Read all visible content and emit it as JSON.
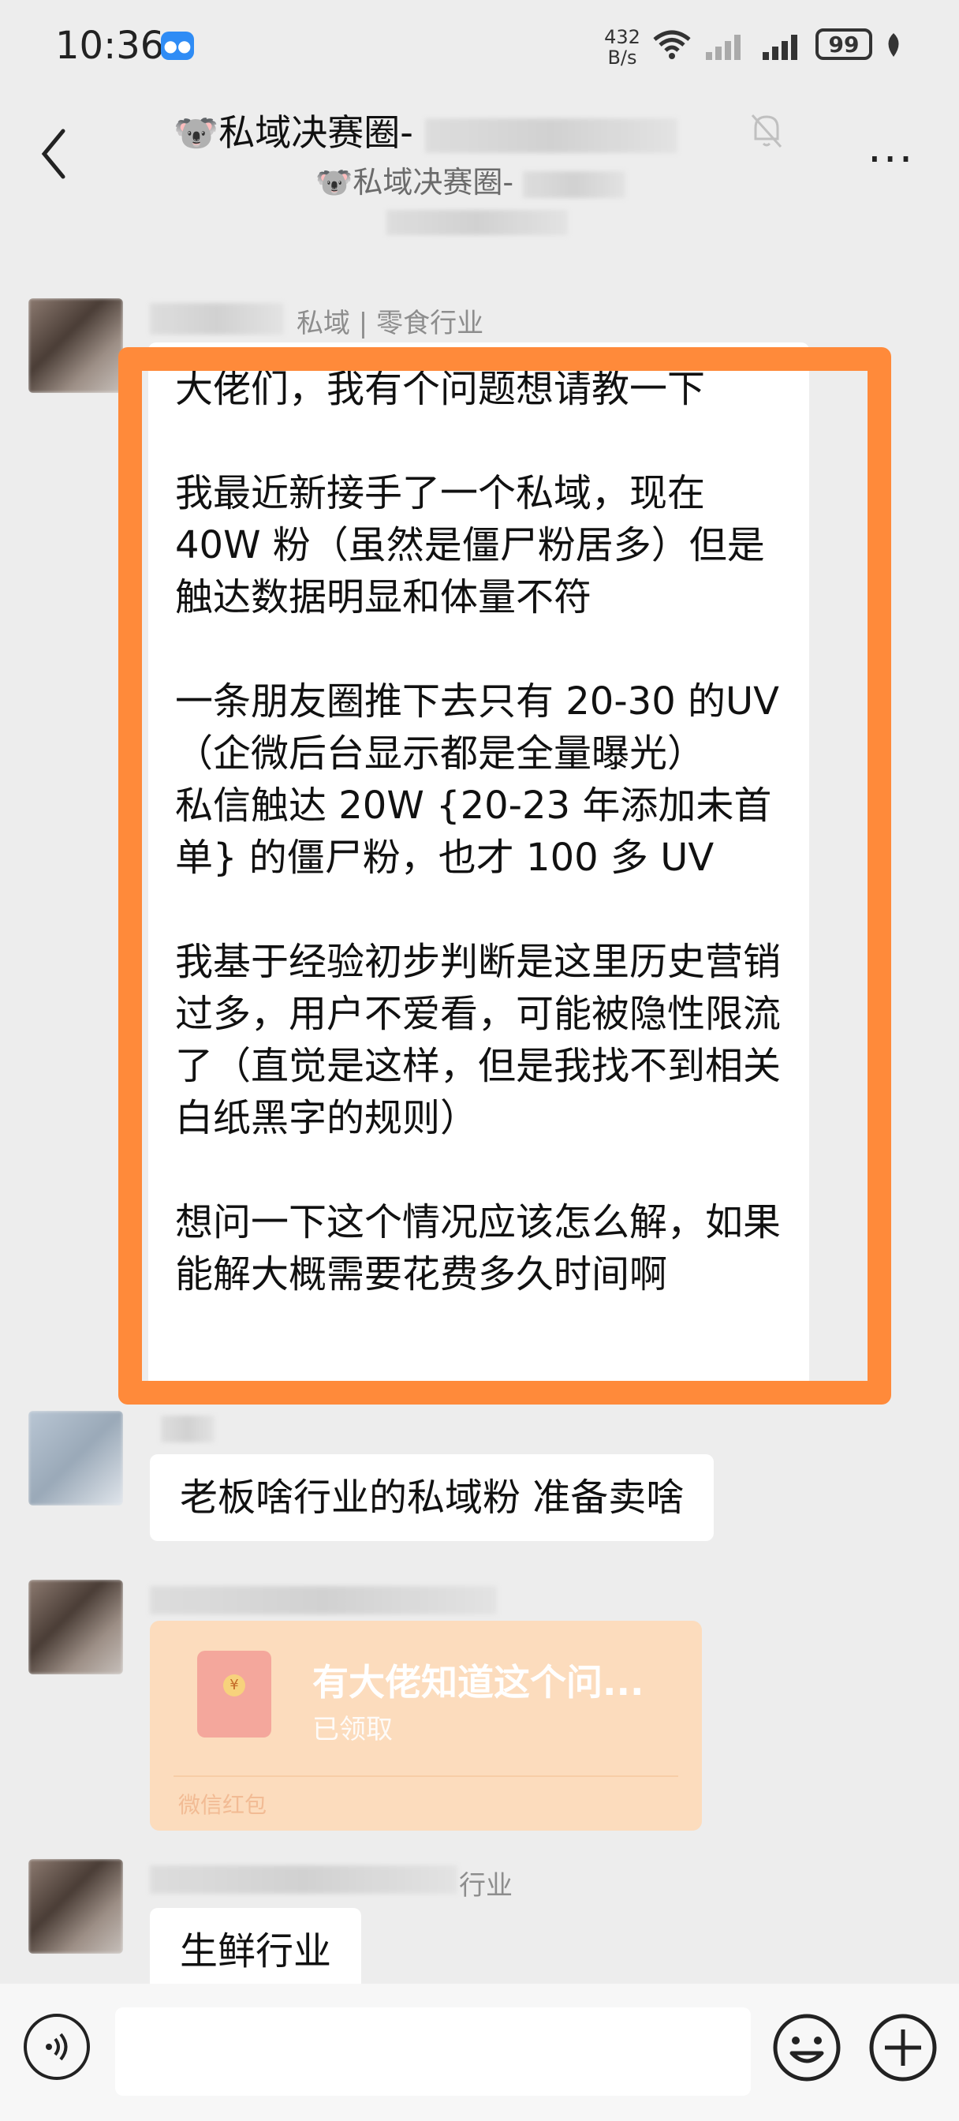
{
  "status_bar": {
    "time": "10:36",
    "net_speed_value": "432",
    "net_speed_unit": "B/s",
    "battery": "99"
  },
  "header": {
    "title": "🐨私域决赛圈-",
    "subtitle": "🐨私域决赛圈-"
  },
  "messages": [
    {
      "sender": "私域 | 零食行业",
      "text": "大佬们，我有个问题想请教一下\n\n我最近新接手了一个私域，现在40W 粉（虽然是僵尸粉居多）但是触达数据明显和体量不符\n\n一条朋友圈推下去只有 20-30 的UV（企微后台显示都是全量曝光）\n私信触达 20W {20-23 年添加未首单} 的僵尸粉，也才 100 多 UV\n\n我基于经验初步判断是这里历史营销过多，用户不爱看，可能被隐性限流了（直觉是这样，但是我找不到相关白纸黑字的规则）\n\n想问一下这个情况应该怎么解，如果能解大概需要花费多久时间啊"
    },
    {
      "text": "老板啥行业的私域粉 准备卖啥"
    },
    {
      "red_packet_title": "有大佬知道这个问...",
      "red_packet_status": "已领取",
      "red_packet_label": "微信红包"
    },
    {
      "sender": "行业",
      "text": "生鲜行业"
    }
  ],
  "colors": {
    "highlight": "#ff8a3a",
    "background": "#ededed",
    "red_packet": "#fcdcbd"
  },
  "icons": [
    "back-icon",
    "mute-icon",
    "more-icon",
    "voice-icon",
    "emoji-icon",
    "plus-icon",
    "wifi-icon",
    "signal-icon",
    "battery-icon",
    "leaf-icon"
  ]
}
